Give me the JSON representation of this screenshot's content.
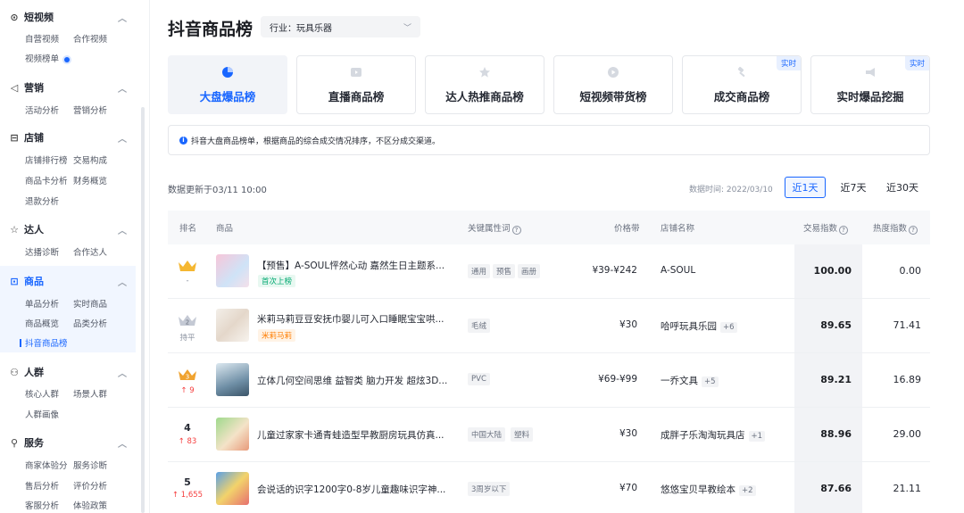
{
  "sidebar": {
    "sections": [
      {
        "name": "短视频",
        "icon": "video-circle-icon",
        "items": [
          "自营视频",
          "合作视频",
          "视频榜单"
        ]
      },
      {
        "name": "营销",
        "icon": "megaphone-icon",
        "items": [
          "活动分析",
          "营销分析"
        ]
      },
      {
        "name": "店铺",
        "icon": "store-icon",
        "items": [
          "店铺排行榜",
          "交易构成",
          "商品卡分析",
          "财务概览",
          "退款分析"
        ]
      },
      {
        "name": "达人",
        "icon": "star-person-icon",
        "items": [
          "达播诊断",
          "合作达人"
        ]
      },
      {
        "name": "商品",
        "icon": "goods-icon",
        "items": [
          "单品分析",
          "实时商品",
          "商品概览",
          "品类分析",
          "抖音商品榜"
        ]
      },
      {
        "name": "人群",
        "icon": "crowd-icon",
        "items": [
          "核心人群",
          "场景人群",
          "人群画像"
        ]
      },
      {
        "name": "服务",
        "icon": "service-icon",
        "items": [
          "商家体验分",
          "服务诊断",
          "售后分析",
          "评价分析",
          "客服分析",
          "体验政策"
        ]
      }
    ]
  },
  "header": {
    "title": "抖音商品榜",
    "industry": "行业：玩具乐器"
  },
  "tabs": [
    {
      "label": "大盘爆品榜",
      "icon": "pie-chart-icon",
      "active": true
    },
    {
      "label": "直播商品榜",
      "icon": "live-play-icon"
    },
    {
      "label": "达人热推商品榜",
      "icon": "star-badge-icon"
    },
    {
      "label": "短视频带货榜",
      "icon": "video-play-icon"
    },
    {
      "label": "成交商品榜",
      "icon": "gavel-icon",
      "badge": "实时"
    },
    {
      "label": "实时爆品挖掘",
      "icon": "megaphone-icon",
      "badge": "实时"
    }
  ],
  "notice": "抖音大盘商品榜单，根据商品的综合成交情况排序，不区分成交渠道。",
  "update_text": "数据更新于03/11 10:00",
  "data_time": "数据时间: 2022/03/10",
  "ranges": [
    "近1天",
    "近7天",
    "近30天"
  ],
  "table": {
    "headers": {
      "rank": "排名",
      "product": "商品",
      "attr": "关键属性词",
      "price": "价格带",
      "shop": "店铺名称",
      "trade": "交易指数",
      "heat": "热度指数"
    },
    "rows": [
      {
        "rank": "",
        "change": "-",
        "name": "【预售】A-SOUL怦然心动 嘉然生日主题系...",
        "tag": "首次上榜",
        "attrs": [
          "通用",
          "预售",
          "画册"
        ],
        "price": "¥39-¥242",
        "shop": "A-SOUL",
        "more": "",
        "trade": "100.00",
        "heat": "0.00"
      },
      {
        "rank": "2",
        "change": "持平",
        "name": "米莉马莉豆豆安抚巾婴儿可入口睡眠宝宝哄...",
        "tag": "米莉马莉",
        "attrs": [
          "毛绒"
        ],
        "price": "¥30",
        "shop": "哈呼玩具乐园",
        "more": "+6",
        "trade": "89.65",
        "heat": "71.41"
      },
      {
        "rank": "3",
        "change": "↑ 9",
        "name": "立体几何空间思维 益智类 脑力开发 超炫3D...",
        "tag": "",
        "attrs": [
          "PVC"
        ],
        "price": "¥69-¥99",
        "shop": "一乔文具",
        "more": "+5",
        "trade": "89.21",
        "heat": "16.89"
      },
      {
        "rank": "4",
        "change": "↑ 83",
        "name": "儿童过家家卡通青蛙造型早教厨房玩具仿真...",
        "tag": "",
        "attrs": [
          "中国大陆",
          "塑料"
        ],
        "price": "¥30",
        "shop": "成胖子乐淘淘玩具店",
        "more": "+1",
        "trade": "88.96",
        "heat": "29.00"
      },
      {
        "rank": "5",
        "change": "↑ 1,655",
        "name": "会说话的识字1200字0-8岁儿童趣味识字神...",
        "tag": "",
        "attrs": [
          "3周岁以下"
        ],
        "price": "¥70",
        "shop": "悠悠宝贝早教绘本",
        "more": "+2",
        "trade": "87.66",
        "heat": "21.11"
      }
    ]
  },
  "colors": {
    "accent": "#1966ff",
    "up": "#f53f3f",
    "gold": "#f5b731",
    "silver": "#c4c9d4"
  }
}
